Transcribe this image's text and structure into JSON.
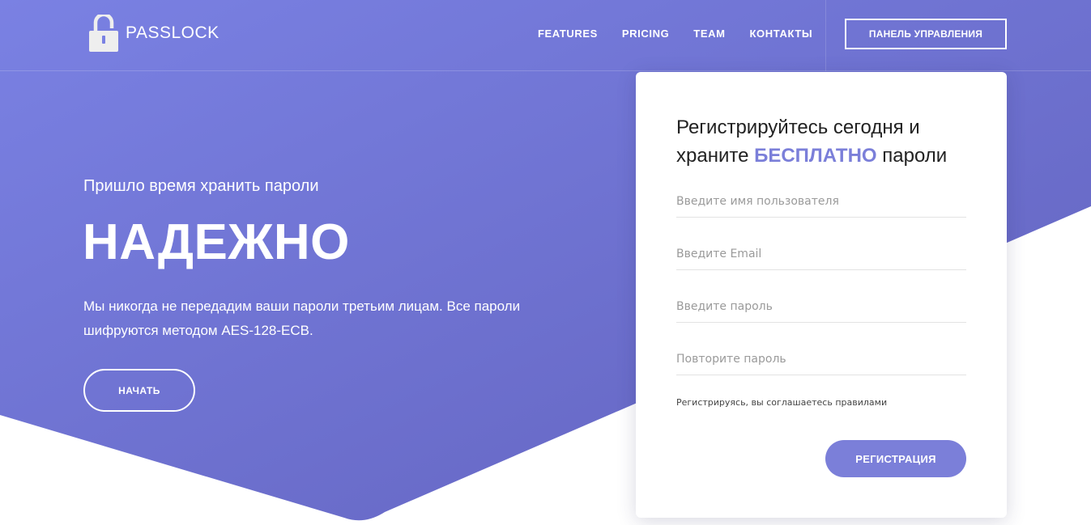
{
  "colors": {
    "gradient_start": "#7a81e3",
    "gradient_end": "#6262bd",
    "accent": "#7b7fd9",
    "text_dark": "#222222",
    "placeholder": "#9a9a9a"
  },
  "header": {
    "logo_text": "PASSLOCK",
    "logo_icon": "padlock-icon",
    "nav": [
      "FEATURES",
      "PRICING",
      "TEAM",
      "КОНТАКТЫ"
    ],
    "cta_label": "ПАНЕЛЬ УПРАВЛЕНИЯ"
  },
  "hero": {
    "subtitle": "Пришло время хранить пароли",
    "title": "НАДЕЖНО",
    "text": "Мы никогда не передадим ваши пароли третьим лицам. Все пароли шифруются методом AES-128-ECB.",
    "button_label": "НАЧАТЬ"
  },
  "form": {
    "heading_part1": "Регистрируйтесь сегодня и храните ",
    "heading_accent": "БЕСПЛАТНО",
    "heading_part2": " пароли",
    "username_placeholder": "Введите имя пользователя",
    "email_placeholder": "Введите Email",
    "password_placeholder": "Введите пароль",
    "password_repeat_placeholder": "Повторите пароль",
    "agreement_text": "Регистрируясь, вы соглашаетесь ",
    "agreement_link": "правилами",
    "submit_label": "РЕГИСТРАЦИЯ"
  }
}
